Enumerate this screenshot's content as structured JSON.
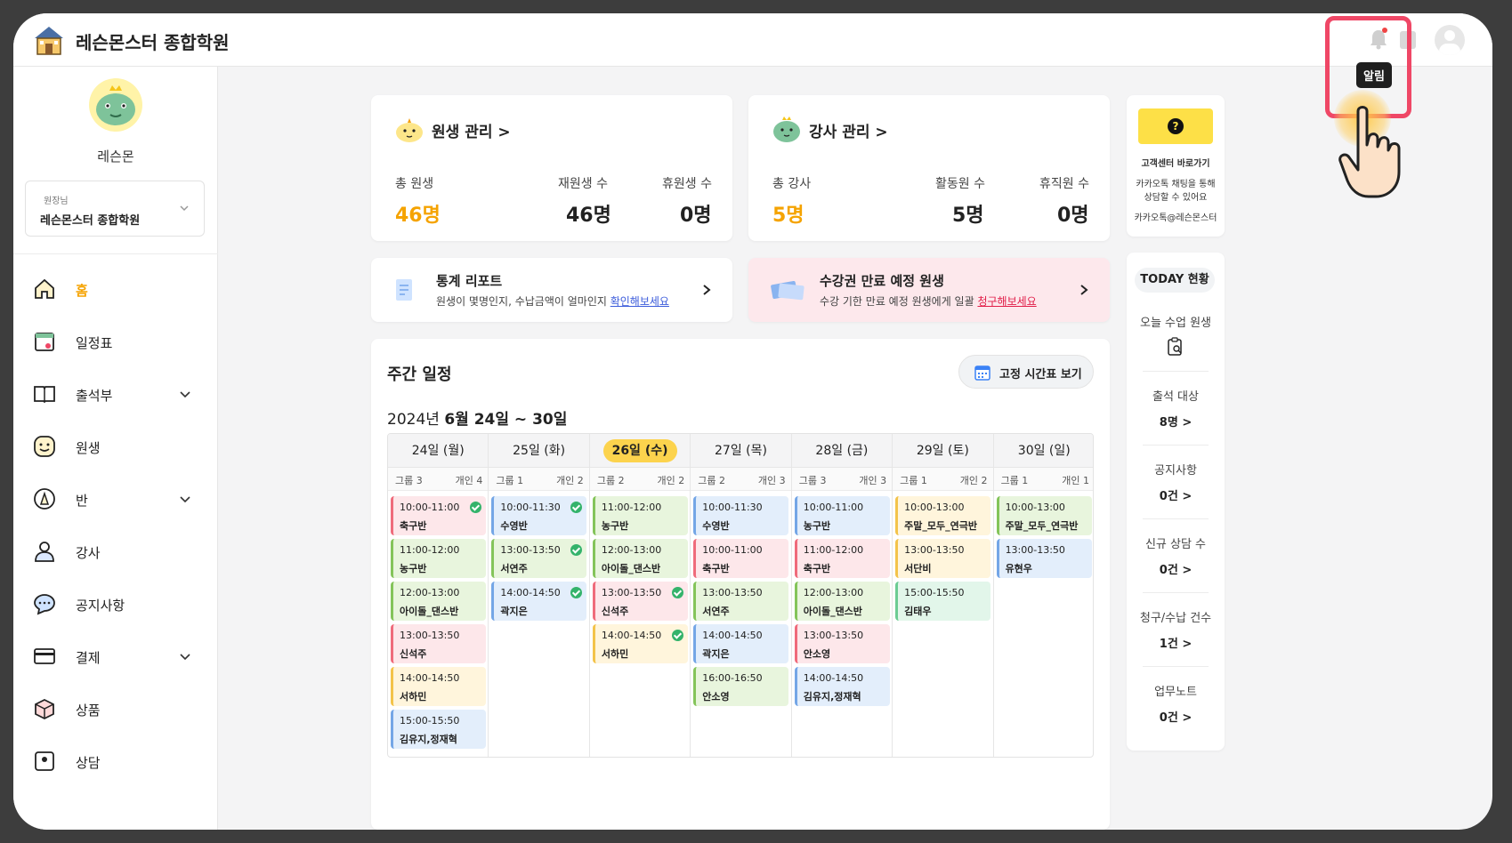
{
  "app": {
    "brand": "레슨몬스터 종합학원",
    "tooltip": "알림"
  },
  "sidebar": {
    "user_name": "레슨몬",
    "academy_role": "원장님",
    "academy_name": "레슨몬스터 종합학원",
    "items": [
      {
        "label": "홈",
        "icon": "home-icon",
        "active": true
      },
      {
        "label": "일정표",
        "icon": "calendar-icon"
      },
      {
        "label": "출석부",
        "icon": "book-icon",
        "expandable": true
      },
      {
        "label": "원생",
        "icon": "smile-icon"
      },
      {
        "label": "반",
        "icon": "class-icon",
        "expandable": true
      },
      {
        "label": "강사",
        "icon": "person-icon"
      },
      {
        "label": "공지사항",
        "icon": "chat-icon"
      },
      {
        "label": "결제",
        "icon": "card-icon",
        "expandable": true
      },
      {
        "label": "상품",
        "icon": "box-icon"
      },
      {
        "label": "상담",
        "icon": "consult-icon"
      }
    ]
  },
  "students": {
    "title": "원생 관리 >",
    "total_label": "총 원생",
    "total": "46명",
    "enrolled_label": "재원생 수",
    "enrolled": "46명",
    "leave_label": "휴원생 수",
    "leave": "0명"
  },
  "teachers": {
    "title": "강사 관리 >",
    "total_label": "총 강사",
    "total": "5명",
    "active_label": "활동원 수",
    "active": "5명",
    "leave_label": "휴직원 수",
    "leave": "0명"
  },
  "report_banner": {
    "title": "통계 리포트",
    "subtitle": "원생이 몇명인지, 수납금액이 얼마인지 ",
    "link": "확인해보세요"
  },
  "expire_banner": {
    "title": "수강권 만료 예정 원생",
    "subtitle": "수강 기한 만료 예정 원생에게 일괄 ",
    "link": "청구해보세요"
  },
  "weekly": {
    "title": "주간 일정",
    "fixed_button": "고정 시간표 보기",
    "range_prefix": "2024년 ",
    "range_main": "6월 24일 ~ 30일",
    "days": [
      {
        "label": "24일 (월)",
        "left": "그룹 3",
        "right": "개인 4",
        "events": [
          {
            "time": "10:00-11:00",
            "name": "축구반",
            "color": "red",
            "check": true
          },
          {
            "time": "11:00-12:00",
            "name": "농구반",
            "color": "green"
          },
          {
            "time": "12:00-13:00",
            "name": "아이돌_댄스반",
            "color": "green"
          },
          {
            "time": "13:00-13:50",
            "name": "신석주",
            "color": "red"
          },
          {
            "time": "14:00-14:50",
            "name": "서하민",
            "color": "yellow"
          },
          {
            "time": "15:00-15:50",
            "name": "김유지,정재혁",
            "color": "blue"
          }
        ]
      },
      {
        "label": "25일 (화)",
        "left": "그룹 1",
        "right": "개인 2",
        "events": [
          {
            "time": "10:00-11:30",
            "name": "수영반",
            "color": "blue",
            "check": true
          },
          {
            "time": "13:00-13:50",
            "name": "서연주",
            "color": "green",
            "check": true
          },
          {
            "time": "14:00-14:50",
            "name": "곽지은",
            "color": "blue",
            "check": true
          }
        ]
      },
      {
        "label": "26일 (수)",
        "today": true,
        "left": "그룹 2",
        "right": "개인 2",
        "events": [
          {
            "time": "11:00-12:00",
            "name": "농구반",
            "color": "green"
          },
          {
            "time": "12:00-13:00",
            "name": "아이돌_댄스반",
            "color": "green"
          },
          {
            "time": "13:00-13:50",
            "name": "신석주",
            "color": "red",
            "check": true
          },
          {
            "time": "14:00-14:50",
            "name": "서하민",
            "color": "yellow",
            "check": true
          }
        ]
      },
      {
        "label": "27일 (목)",
        "left": "그룹 2",
        "right": "개인 3",
        "events": [
          {
            "time": "10:00-11:30",
            "name": "수영반",
            "color": "blue"
          },
          {
            "time": "10:00-11:00",
            "name": "축구반",
            "color": "red"
          },
          {
            "time": "13:00-13:50",
            "name": "서연주",
            "color": "green"
          },
          {
            "time": "14:00-14:50",
            "name": "곽지은",
            "color": "blue"
          },
          {
            "time": "16:00-16:50",
            "name": "안소영",
            "color": "green"
          }
        ]
      },
      {
        "label": "28일 (금)",
        "left": "그룹 3",
        "right": "개인 3",
        "events": [
          {
            "time": "10:00-11:00",
            "name": "농구반",
            "color": "blue"
          },
          {
            "time": "11:00-12:00",
            "name": "축구반",
            "color": "red"
          },
          {
            "time": "12:00-13:00",
            "name": "아이돌_댄스반",
            "color": "green"
          },
          {
            "time": "13:00-13:50",
            "name": "안소영",
            "color": "red"
          },
          {
            "time": "14:00-14:50",
            "name": "김유지,정재혁",
            "color": "blue"
          }
        ]
      },
      {
        "label": "29일 (토)",
        "left": "그룹 1",
        "right": "개인 2",
        "events": [
          {
            "time": "10:00-13:00",
            "name": "주말_모두_연극반",
            "color": "yellow"
          },
          {
            "time": "13:00-13:50",
            "name": "서단비",
            "color": "yellow"
          },
          {
            "time": "15:00-15:50",
            "name": "김태우",
            "color": "mint"
          }
        ]
      },
      {
        "label": "30일 (일)",
        "left": "그룹 1",
        "right": "개인 1",
        "events": [
          {
            "time": "10:00-13:00",
            "name": "주말_모두_연극반",
            "color": "green"
          },
          {
            "time": "13:00-13:50",
            "name": "유현우",
            "color": "blue"
          }
        ]
      }
    ]
  },
  "help": {
    "title": "고객센터 바로가기",
    "line1": "카카오톡 채팅을 통해",
    "line2": "상담할 수 있어요",
    "kakao": "카카오톡@레슨몬스터"
  },
  "today": {
    "title": "TODAY 현황",
    "items": [
      {
        "label": "오늘 수업 원생",
        "value": ""
      },
      {
        "label": "출석 대상",
        "value": "8명 >"
      },
      {
        "label": "공지사항",
        "value": "0건 >"
      },
      {
        "label": "신규 상담 수",
        "value": "0건 >"
      },
      {
        "label": "청구/수납 건수",
        "value": "1건 >"
      },
      {
        "label": "업무노트",
        "value": "0건 >"
      }
    ]
  },
  "colors": {
    "accent": "#f5a300",
    "today_pill": "#fcd34d",
    "highlight": "#ef4766"
  }
}
